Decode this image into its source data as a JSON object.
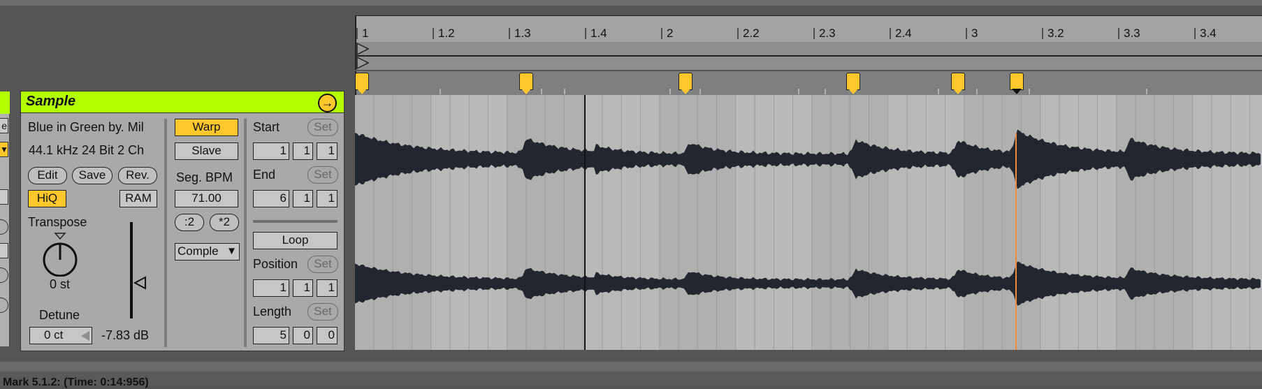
{
  "status_text": "Mark 5.1.2: (Time: 0:14:956)",
  "left_device": {
    "button_partial": "e",
    "dropdown_partial": "▼"
  },
  "sample": {
    "title": "Sample",
    "file_name": "Blue in Green by. Mil",
    "file_info": "44.1 kHz 24 Bit 2 Ch",
    "edit_label": "Edit",
    "save_label": "Save",
    "rev_label": "Rev.",
    "hiq_label": "HiQ",
    "ram_label": "RAM",
    "transpose_label": "Transpose",
    "transpose_value": "0 st",
    "detune_label": "Detune",
    "detune_value": "0 ct",
    "volume_value": "-7.83 dB",
    "warp_label": "Warp",
    "slave_label": "Slave",
    "seg_bpm_label": "Seg. BPM",
    "seg_bpm_value": "71.00",
    "half_label": ":2",
    "double_label": "*2",
    "warp_mode": "Comple",
    "warp_mode_arrow": "▼",
    "start_label": "Start",
    "start_set": "Set",
    "start_values": [
      "1",
      "1",
      "1"
    ],
    "end_label": "End",
    "end_set": "Set",
    "end_values": [
      "6",
      "1",
      "1"
    ],
    "loop_label": "Loop",
    "position_label": "Position",
    "position_set": "Set",
    "position_values": [
      "1",
      "1",
      "1"
    ],
    "length_label": "Length",
    "length_set": "Set",
    "length_values": [
      "5",
      "0",
      "0"
    ],
    "volume_level": 0.5
  },
  "timeline": {
    "ruler_labels": [
      "1",
      "1.2",
      "1.3",
      "1.4",
      "2",
      "2.2",
      "2.3",
      "2.4",
      "3",
      "3.2",
      "3.3",
      "3.4"
    ],
    "warp_marker_count": 6,
    "selected_marker_index": 5
  },
  "colors": {
    "accent": "#b3ff00",
    "marker": "#ffc72c",
    "waveform": "#22262e",
    "playhead": "#f08a3c"
  }
}
